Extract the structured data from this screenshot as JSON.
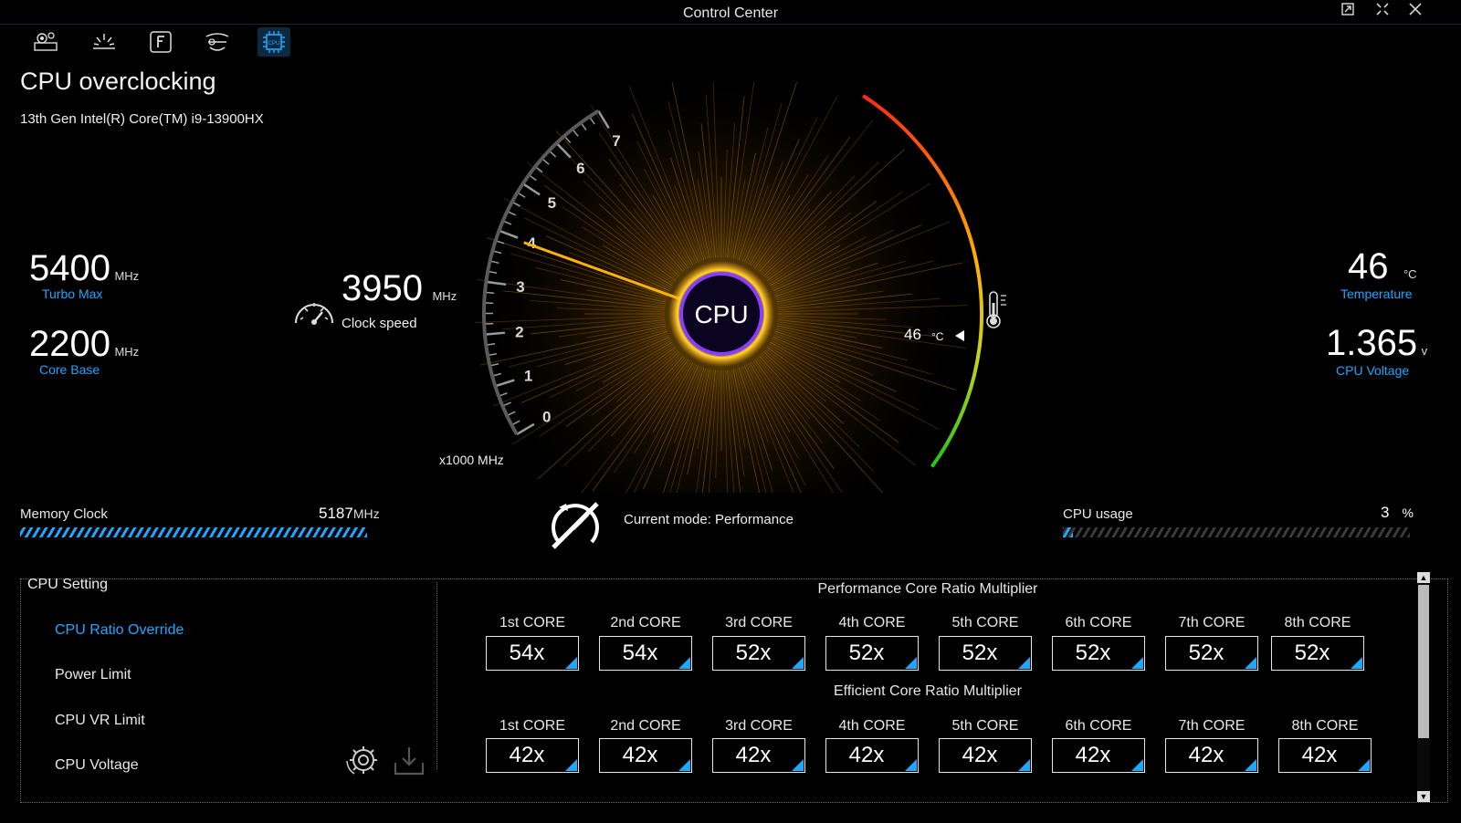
{
  "window": {
    "title": "Control Center"
  },
  "nav": {
    "icons": [
      "system-settings-icon",
      "brightness-icon",
      "function-key-icon",
      "fan-icon",
      "cpu-chip-icon"
    ],
    "active": "cpu-chip-icon"
  },
  "page": {
    "title": "CPU overclocking",
    "cpu_model": "13th Gen Intel(R) Core(TM) i9-13900HX"
  },
  "left_stats": {
    "turbo_max": {
      "value": "5400",
      "unit": "MHz",
      "label": "Turbo Max"
    },
    "core_base": {
      "value": "2200",
      "unit": "MHz",
      "label": "Core Base"
    }
  },
  "gauge": {
    "clock_value": "3950",
    "clock_unit": "MHz",
    "clock_label": "Clock speed",
    "center_label": "CPU",
    "scale_ticks": [
      "0",
      "1",
      "2",
      "3",
      "4",
      "5",
      "6",
      "7"
    ],
    "scale_unit": "x1000 MHz",
    "needle_value": 3.95,
    "temp_value": "46",
    "temp_unit": "°C"
  },
  "right_stats": {
    "temperature": {
      "value": "46",
      "unit": "°C",
      "label": "Temperature"
    },
    "voltage": {
      "value": "1.365",
      "unit": "v",
      "label": "CPU Voltage"
    }
  },
  "memory": {
    "label": "Memory Clock",
    "value": "5187",
    "unit": "MHz",
    "fill": 1.0
  },
  "mode": {
    "text": "Current mode: Performance"
  },
  "usage": {
    "label": "CPU usage",
    "value": "3",
    "unit": "%",
    "fill": 0.03
  },
  "settings": {
    "heading": "CPU Setting",
    "items": [
      "CPU Ratio Override",
      "Power Limit",
      "CPU VR Limit",
      "CPU Voltage"
    ],
    "active_index": 0
  },
  "performance": {
    "heading": "Performance Core Ratio Multiplier",
    "cores": [
      {
        "label": "1st CORE",
        "value": "54x"
      },
      {
        "label": "2nd CORE",
        "value": "54x"
      },
      {
        "label": "3rd CORE",
        "value": "52x"
      },
      {
        "label": "4th CORE",
        "value": "52x"
      },
      {
        "label": "5th CORE",
        "value": "52x"
      },
      {
        "label": "6th CORE",
        "value": "52x"
      },
      {
        "label": "7th CORE",
        "value": "52x"
      },
      {
        "label": "8th CORE",
        "value": "52x"
      }
    ]
  },
  "efficient": {
    "heading": "Efficient Core Ratio Multiplier",
    "cores": [
      {
        "label": "1st CORE",
        "value": "42x"
      },
      {
        "label": "2nd CORE",
        "value": "42x"
      },
      {
        "label": "3rd CORE",
        "value": "42x"
      },
      {
        "label": "4th CORE",
        "value": "42x"
      },
      {
        "label": "5th CORE",
        "value": "42x"
      },
      {
        "label": "6th CORE",
        "value": "42x"
      },
      {
        "label": "7th CORE",
        "value": "42x"
      },
      {
        "label": "8th CORE",
        "value": "42x"
      }
    ]
  },
  "colors": {
    "accent": "#1fa6ff",
    "gauge_glow": "#ffb300",
    "temp_red": "#ff2a1a",
    "temp_green": "#22c41a"
  }
}
